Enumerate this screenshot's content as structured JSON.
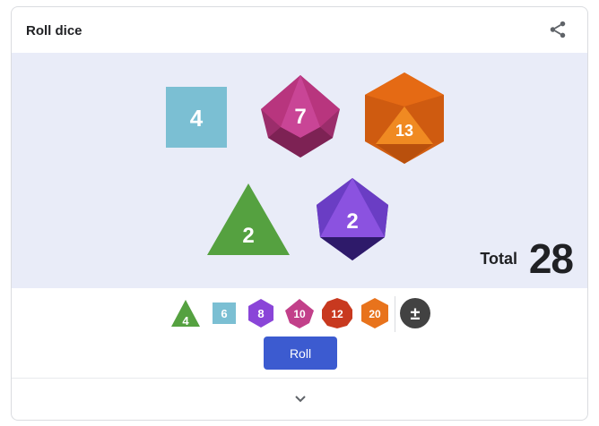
{
  "card": {
    "title": "Roll dice"
  },
  "icons": {
    "share": "share-icon",
    "expand": "chevron-down-icon",
    "plus_minus": "plus-minus-icon"
  },
  "dice": [
    {
      "type": "d6",
      "shape": "square",
      "value": "4",
      "color": "#7bbfd3"
    },
    {
      "type": "d10",
      "shape": "pentagonal-trapezohedron",
      "value": "7",
      "color": "#c2408a"
    },
    {
      "type": "d20",
      "shape": "icosahedron",
      "value": "13",
      "color": "#e8731c"
    },
    {
      "type": "d4",
      "shape": "tetrahedron",
      "value": "2",
      "color": "#55a140"
    },
    {
      "type": "d8",
      "shape": "octahedron",
      "value": "2",
      "color": "#7a4bd8"
    }
  ],
  "total": {
    "label": "Total",
    "value": "28"
  },
  "dice_picker": [
    {
      "label": "4",
      "color": "#55a140",
      "die": "d4"
    },
    {
      "label": "6",
      "color": "#7bbfd3",
      "die": "d6"
    },
    {
      "label": "8",
      "color": "#8a45d8",
      "die": "d8"
    },
    {
      "label": "10",
      "color": "#c2408a",
      "die": "d10"
    },
    {
      "label": "12",
      "color": "#c8391f",
      "die": "d12"
    },
    {
      "label": "20",
      "color": "#e8731c",
      "die": "d20"
    },
    {
      "label": "±",
      "color": "#424242",
      "die": "modifier"
    }
  ],
  "actions": {
    "roll_label": "Roll"
  },
  "colors": {
    "stage_background": "#e9ecf8",
    "roll_button": "#3c5bd0"
  }
}
